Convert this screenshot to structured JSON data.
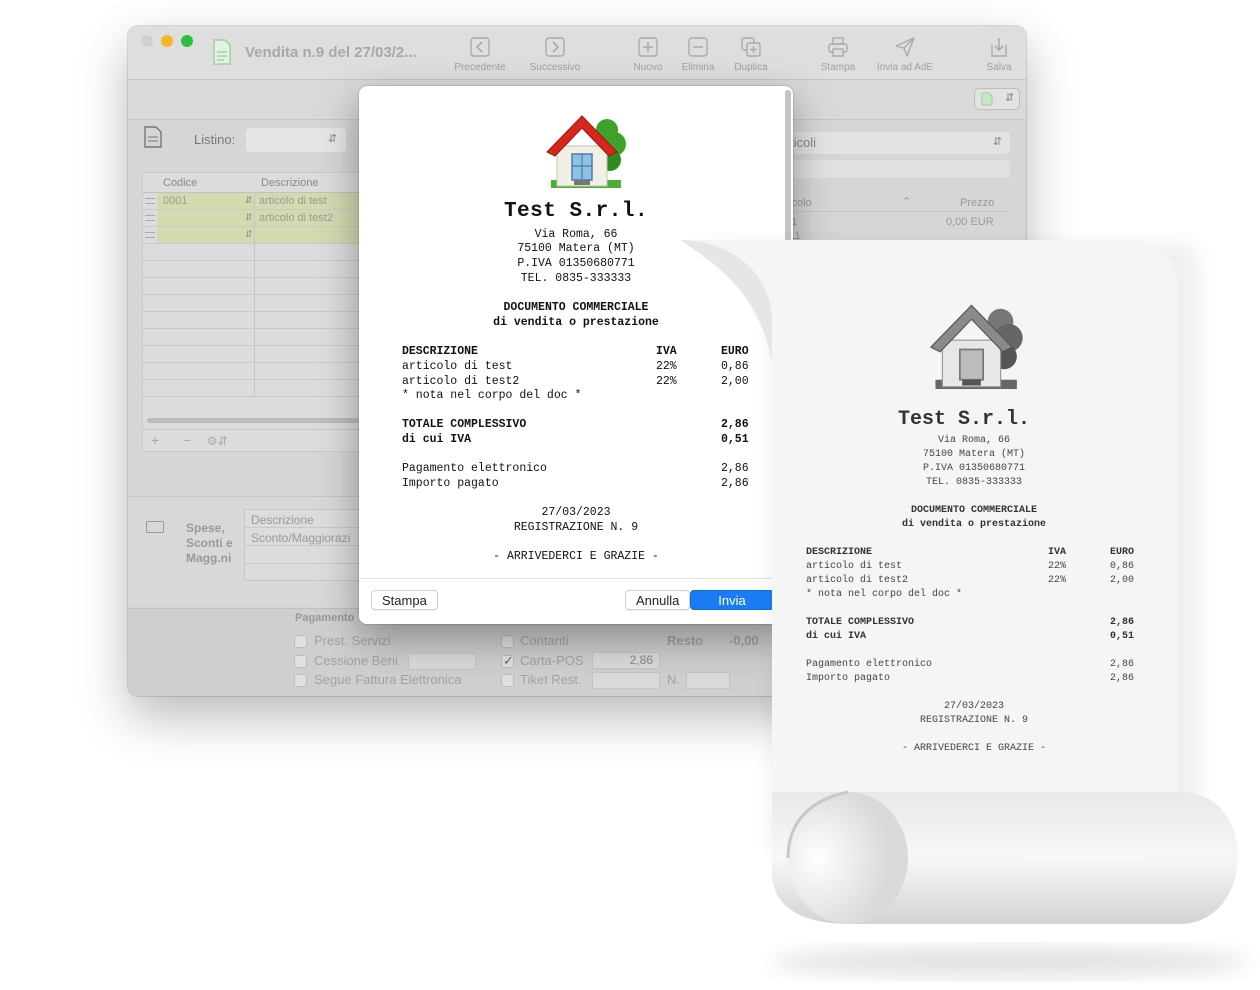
{
  "window": {
    "title": "Vendita n.9 del 27/03/2...",
    "toolbar": {
      "prev": "Precedente",
      "next": "Successivo",
      "new": "Nuovo",
      "delete": "Elimina",
      "duplicate": "Duplica",
      "print": "Stampa",
      "send_ade": "Invia ad AdE",
      "save": "Salva"
    }
  },
  "listino": {
    "label": "Listino:"
  },
  "grid": {
    "headers": {
      "code": "Codice",
      "description": "Descrizione"
    },
    "rows": [
      {
        "code": "0001",
        "description": "articolo di test"
      },
      {
        "code": "",
        "description": "articolo di test2"
      },
      {
        "code": "",
        "description": ""
      }
    ],
    "footer": {
      "add": "+",
      "remove": "−"
    }
  },
  "spese": {
    "label_line1": "Spese,",
    "label_line2": "Sconti e",
    "label_line3": "Magg.ni",
    "header": "Descrizione",
    "row1": "Sconto/Maggiorazi"
  },
  "right_panel": {
    "select": "ticoli",
    "col_articolo": "ticolo",
    "col_prezzo": "Prezzo",
    "row1_code": "11",
    "row1_price": "0,00 EUR",
    "row2_code": "t11"
  },
  "payment": {
    "title": "Pagamento",
    "prest_servizi": "Prest. Servizi",
    "cessione_beni": "Cessione Beni",
    "segue_fattura": "Segue Fattura Elettronica",
    "contanti": "Contanti",
    "carta_pos": "Carta-POS",
    "carta_pos_value": "2,86",
    "ticket": "Tiket Rest.",
    "resto_label": "Resto",
    "resto_value": "-0,00",
    "n_label": "N."
  },
  "receipt": {
    "company": "Test S.r.l.",
    "address": "Via Roma, 66",
    "city": "75100 Matera (MT)",
    "vat": "P.IVA 01350680771",
    "tel": "TEL. 0835-333333",
    "doc_title": "DOCUMENTO COMMERCIALE",
    "doc_subtitle": "di vendita o prestazione",
    "col_desc": "DESCRIZIONE",
    "col_iva": "IVA",
    "col_euro": "EURO",
    "items": [
      {
        "desc": "articolo di test",
        "iva": "22%",
        "euro": "0,86"
      },
      {
        "desc": "articolo di test2",
        "iva": "22%",
        "euro": "2,00"
      }
    ],
    "note": "* nota nel corpo del doc *",
    "total_label": "TOTALE COMPLESSIVO",
    "total_value": "2,86",
    "vat_label": "di cui IVA",
    "vat_value": "0,51",
    "payment_label": "Pagamento elettronico",
    "payment_value": "2,86",
    "paid_label": "Importo pagato",
    "paid_value": "2,86",
    "date": "27/03/2023",
    "registration": "REGISTRAZIONE N. 9",
    "farewell": "- ARRIVEDERCI E GRAZIE -"
  },
  "dialog": {
    "print_button": "Stampa",
    "cancel_button": "Annulla",
    "send_button": "Invia"
  },
  "colors": {
    "primary_button": "#1a7cf5",
    "highlight_row": "#d5d9b0",
    "house_roof": "#d8261c",
    "tree": "#3fa12b"
  }
}
